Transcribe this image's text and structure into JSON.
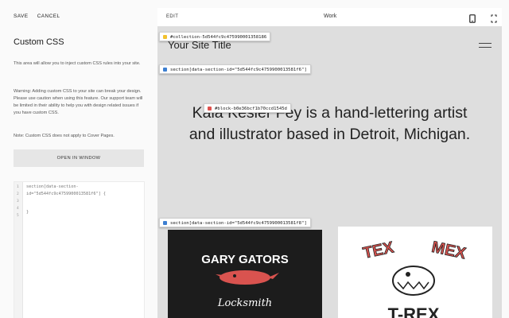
{
  "toolbar": {
    "save_label": "SAVE",
    "cancel_label": "CANCEL"
  },
  "panel": {
    "title": "Custom CSS",
    "intro": "This area will allow you to inject custom CSS rules into your site.",
    "warning": "Warning: Adding custom CSS to your site can break your design. Please use caution when using this feature. Our support team will be limited in their ability to help you with design related issues if you have custom CSS.",
    "note": "Note: Custom CSS does not apply to Cover Pages.",
    "open_window_label": "OPEN IN WINDOW"
  },
  "editor": {
    "lines": [
      "1",
      "2",
      "3",
      "4",
      "5"
    ],
    "code_line1": "section[data-section-",
    "code_line2": "id=\"5d544fc9c4759900013581f6\"] {",
    "code_line3": "}"
  },
  "preview": {
    "edit_label": "EDIT",
    "page_label": "Work",
    "site_title": "Your Site Title",
    "headline": "Kala Kesler Fey is a hand-lettering artist and illustrator based in Detroit, Michigan.",
    "image1_text1": "GARY GATORS",
    "image1_text2": "Locksmith",
    "image2_text1": "TEX",
    "image2_text2": "MEX",
    "image2_text3": "T-REX"
  },
  "selector_tags": {
    "collection": "#collection-5d544fc9c475990001358186",
    "section1": "section[data-section-id=\"5d544fc9c4759900013581f6\"]",
    "block": "#block-b0e36bcf1b70ccd1545d",
    "section2": "section[data-section-id=\"5d544fc9c4759900013581f8\"]"
  },
  "colors": {
    "collection_dot": "#f2c12e",
    "section_dot": "#3d7fd1",
    "block_dot": "#e0524e",
    "site_bg": "#dedede"
  },
  "icons": {
    "device": "mobile-icon",
    "menu": "hamburger-icon"
  }
}
